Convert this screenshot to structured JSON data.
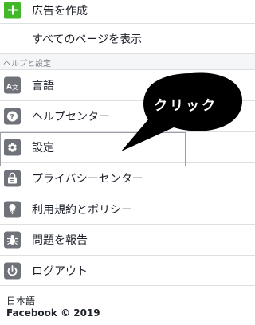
{
  "menu_top": {
    "create_ad": "広告を作成",
    "view_all_pages": "すべてのページを表示"
  },
  "section": {
    "header": "ヘルプと設定"
  },
  "help_items": {
    "language": "言語",
    "help_center": "ヘルプセンター",
    "settings": "設定",
    "privacy_center": "プライバシーセンター",
    "terms": "利用規約とポリシー",
    "report_problem": "問題を報告",
    "logout": "ログアウト"
  },
  "annotation": {
    "callout_text": "クリック"
  },
  "footer": {
    "language": "日本語",
    "copyright": "Facebook © 2019"
  },
  "colors": {
    "icon_gray": "#6f7379",
    "create_green": "#42b72a",
    "callout": "#000000",
    "section_bg": "#f5f6f7"
  },
  "icons": {
    "create_ad": "plus-icon",
    "language": "translate-icon",
    "help_center": "question-icon",
    "settings": "gear-icon",
    "privacy_center": "lock-icon",
    "terms": "shield-icon",
    "report_problem": "bug-icon",
    "logout": "power-icon"
  }
}
